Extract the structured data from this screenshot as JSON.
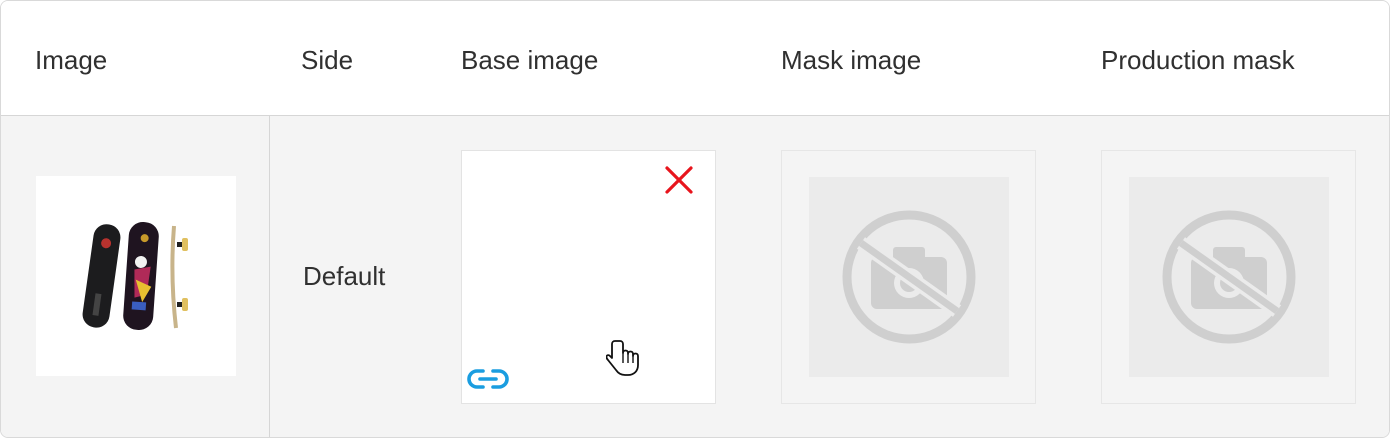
{
  "columns": {
    "image": "Image",
    "side": "Side",
    "base_image": "Base image",
    "mask_image": "Mask image",
    "production_mask": "Production mask"
  },
  "row": {
    "side": "Default",
    "thumbnail_icon": "skateboard-product-image",
    "base_image_state": "empty",
    "mask_image_state": "no-image-placeholder",
    "production_mask_state": "no-image-placeholder"
  },
  "icons": {
    "remove": "close-icon",
    "link": "link-icon",
    "cursor": "hand-pointer-icon",
    "placeholder": "no-camera-icon"
  },
  "colors": {
    "remove": "#e8141c",
    "link": "#1a9de0",
    "row_background": "#f4f4f4",
    "placeholder": "#cfcfcf"
  }
}
